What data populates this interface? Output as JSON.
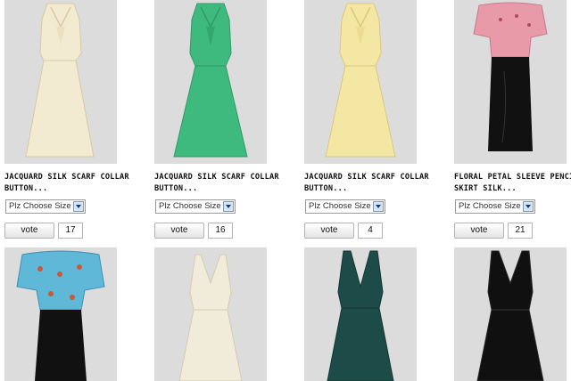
{
  "products": [
    {
      "title": "JACQUARD SILK SCARF COLLAR\nBUTTON...",
      "size_select": "Plz Choose Size",
      "vote_label": "vote",
      "votes": "17",
      "dress_color": "#f3ead2",
      "image": "cream-scarf-collar-dress"
    },
    {
      "title": "JACQUARD SILK SCARF COLLAR\nBUTTON...",
      "size_select": "Plz Choose Size",
      "vote_label": "vote",
      "votes": "16",
      "dress_color": "#3fba7f",
      "image": "green-scarf-collar-dress"
    },
    {
      "title": "JACQUARD SILK SCARF COLLAR\nBUTTON...",
      "size_select": "Plz Choose Size",
      "vote_label": "vote",
      "votes": "4",
      "dress_color": "#f3e7a3",
      "image": "yellow-scarf-collar-dress"
    },
    {
      "title": "FLORAL PETAL SLEEVE PENCIL\nSKIRT SILK...",
      "size_select": "Plz Choose Size",
      "vote_label": "vote",
      "votes": "21",
      "dress_color": "#e89aa8",
      "image": "pink-floral-black-skirt-dress"
    }
  ],
  "second_row": [
    {
      "image": "blue-floral-black-skirt-dress",
      "dress_color": "#5fb8d8"
    },
    {
      "image": "ivory-wrap-dress",
      "dress_color": "#f1ecda"
    },
    {
      "image": "teal-wrap-dress",
      "dress_color": "#1d4c48"
    },
    {
      "image": "black-wrap-dress",
      "dress_color": "#101010"
    }
  ]
}
